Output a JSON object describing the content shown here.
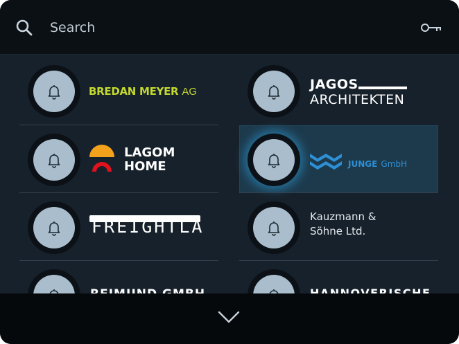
{
  "search": {
    "placeholder": "Search",
    "value": ""
  },
  "colors": {
    "background": "#17212b",
    "topbar": "#0b1015",
    "selected_row": "#1d3a4c",
    "selection_glow": "#2e9edc",
    "bell_fill": "#a9bdcc"
  },
  "entries": [
    {
      "name": "bredan-meyer",
      "logo": {
        "main": "BREDAN MEYER",
        "suffix": "AG"
      }
    },
    {
      "name": "jagos-architekten",
      "logo": {
        "line1": "JAGOS",
        "line2": "ARCHITEKTEN"
      }
    },
    {
      "name": "lagom-home",
      "logo": {
        "line1": "LAGOM",
        "line2": "HOME"
      }
    },
    {
      "name": "junge-gmbh",
      "selected": true,
      "logo": {
        "main": "JUNGE",
        "suffix": "GmbH"
      }
    },
    {
      "name": "freightla",
      "logo": {
        "text": "FREIGHTLA"
      }
    },
    {
      "name": "kauzmann-sohne",
      "logo": {
        "line1": "Kauzmann &",
        "line2": "Söhne Ltd."
      }
    },
    {
      "name": "reimund-gmbh",
      "logo": {
        "text": "REIMUND GMBH"
      }
    },
    {
      "name": "hannoverische",
      "logo": {
        "text": "HANNOVERISCHE"
      }
    }
  ],
  "icons": {
    "search": "search-icon",
    "key": "key-icon",
    "bell": "bell-icon",
    "scroll": "chevron-down-icon"
  }
}
